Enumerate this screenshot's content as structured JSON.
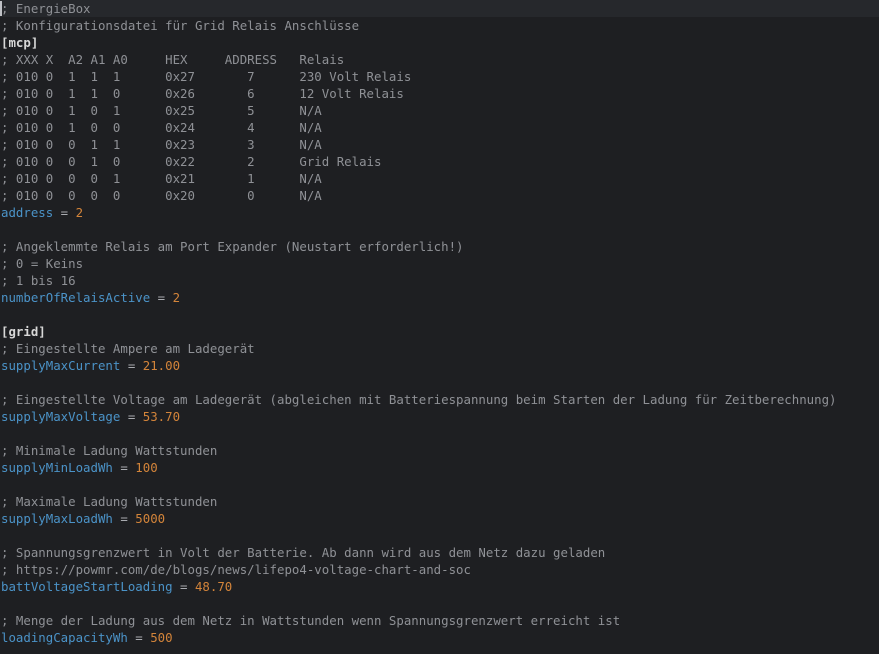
{
  "editor": {
    "lines": [
      {
        "type": "comment",
        "text": "; EnergieBox"
      },
      {
        "type": "comment",
        "text": "; Konfigurationsdatei für Grid Relais Anschlüsse"
      },
      {
        "type": "section",
        "text": "[mcp]"
      },
      {
        "type": "comment",
        "text": "; XXX X  A2 A1 A0     HEX     ADDRESS   Relais"
      },
      {
        "type": "comment",
        "text": "; 010 0  1  1  1      0x27       7      230 Volt Relais"
      },
      {
        "type": "comment",
        "text": "; 010 0  1  1  0      0x26       6      12 Volt Relais"
      },
      {
        "type": "comment",
        "text": "; 010 0  1  0  1      0x25       5      N/A"
      },
      {
        "type": "comment",
        "text": "; 010 0  1  0  0      0x24       4      N/A"
      },
      {
        "type": "comment",
        "text": "; 010 0  0  1  1      0x23       3      N/A"
      },
      {
        "type": "comment",
        "text": "; 010 0  0  1  0      0x22       2      Grid Relais"
      },
      {
        "type": "comment",
        "text": "; 010 0  0  0  1      0x21       1      N/A"
      },
      {
        "type": "comment",
        "text": "; 010 0  0  0  0      0x20       0      N/A"
      },
      {
        "type": "kv",
        "key": "address",
        "op": " = ",
        "value": "2"
      },
      {
        "type": "blank",
        "text": ""
      },
      {
        "type": "comment",
        "text": "; Angeklemmte Relais am Port Expander (Neustart erforderlich!)"
      },
      {
        "type": "comment",
        "text": "; 0 = Keins"
      },
      {
        "type": "comment",
        "text": "; 1 bis 16"
      },
      {
        "type": "kv",
        "key": "numberOfRelaisActive",
        "op": " = ",
        "value": "2"
      },
      {
        "type": "blank",
        "text": ""
      },
      {
        "type": "section",
        "text": "[grid]"
      },
      {
        "type": "comment",
        "text": "; Eingestellte Ampere am Ladegerät"
      },
      {
        "type": "kv",
        "key": "supplyMaxCurrent",
        "op": " = ",
        "value": "21.00"
      },
      {
        "type": "blank",
        "text": ""
      },
      {
        "type": "comment",
        "text": "; Eingestellte Voltage am Ladegerät (abgleichen mit Batteriespannung beim Starten der Ladung für Zeitberechnung)"
      },
      {
        "type": "kv",
        "key": "supplyMaxVoltage",
        "op": " = ",
        "value": "53.70"
      },
      {
        "type": "blank",
        "text": ""
      },
      {
        "type": "comment",
        "text": "; Minimale Ladung Wattstunden"
      },
      {
        "type": "kv",
        "key": "supplyMinLoadWh",
        "op": " = ",
        "value": "100"
      },
      {
        "type": "blank",
        "text": ""
      },
      {
        "type": "comment",
        "text": "; Maximale Ladung Wattstunden"
      },
      {
        "type": "kv",
        "key": "supplyMaxLoadWh",
        "op": " = ",
        "value": "5000"
      },
      {
        "type": "blank",
        "text": ""
      },
      {
        "type": "comment",
        "text": "; Spannungsgrenzwert in Volt der Batterie. Ab dann wird aus dem Netz dazu geladen"
      },
      {
        "type": "comment",
        "text": "; https://powmr.com/de/blogs/news/lifepo4-voltage-chart-and-soc"
      },
      {
        "type": "kv",
        "key": "battVoltageStartLoading",
        "op": " = ",
        "value": "48.70"
      },
      {
        "type": "blank",
        "text": ""
      },
      {
        "type": "comment",
        "text": "; Menge der Ladung aus dem Netz in Wattstunden wenn Spannungsgrenzwert erreicht ist"
      },
      {
        "type": "kv",
        "key": "loadingCapacityWh",
        "op": " = ",
        "value": "500"
      }
    ]
  },
  "colors": {
    "background": "#1e1f22",
    "comment": "#8f9196",
    "section": "#d8d8d8",
    "key": "#4b93c8",
    "number": "#d3843a"
  }
}
